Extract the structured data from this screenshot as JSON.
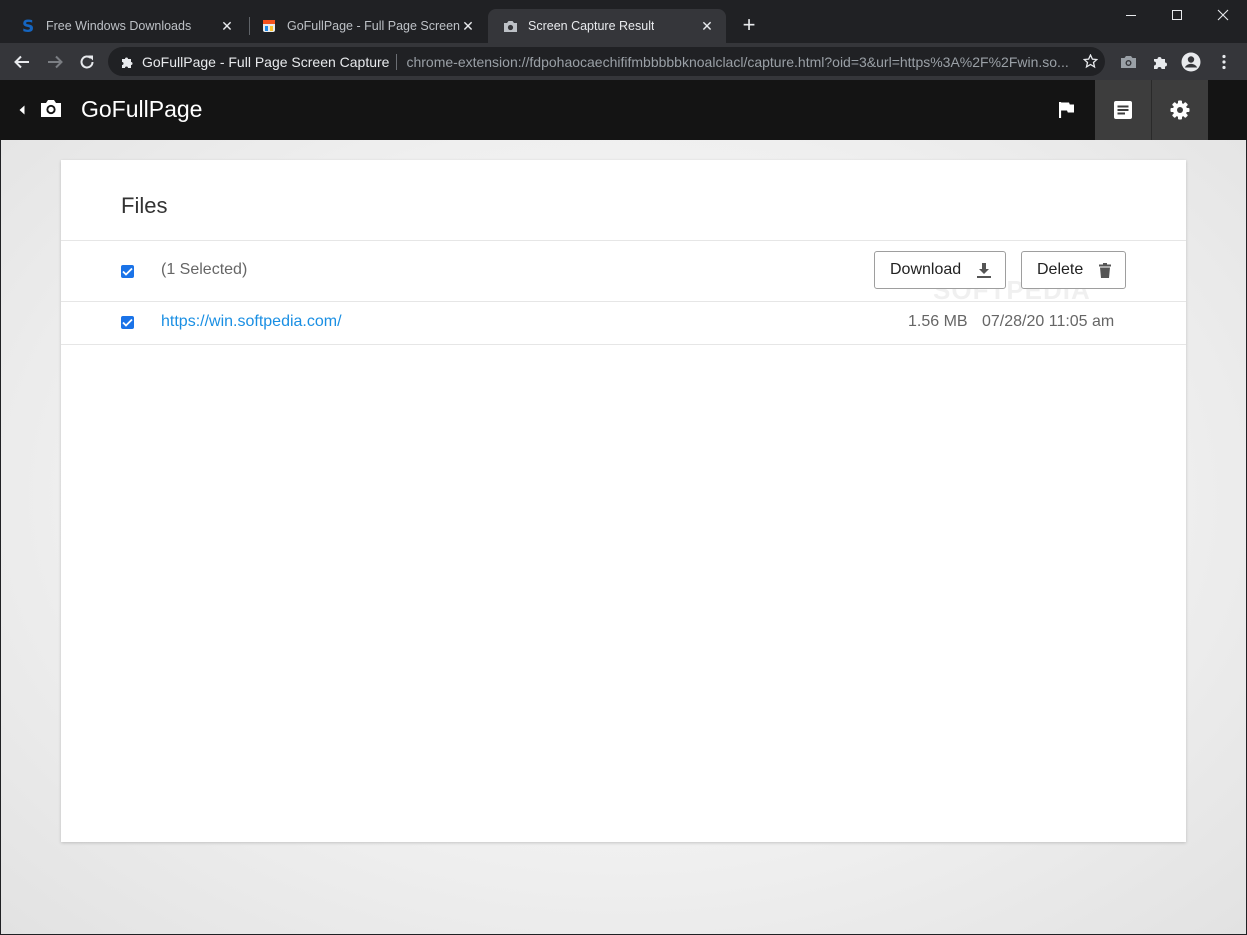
{
  "browser": {
    "tabs": [
      {
        "title": "Free Windows Downloads",
        "favicon": "softpedia-s-icon",
        "active": false
      },
      {
        "title": "GoFullPage - Full Page Screen Ca",
        "favicon": "gofullpage-icon",
        "active": false
      },
      {
        "title": "Screen Capture Result",
        "favicon": "camera-icon",
        "active": true
      }
    ],
    "new_tab_label": "+",
    "omnibox": {
      "site_name": "GoFullPage - Full Page Screen Capture",
      "url": "chrome-extension://fdpohaocaechififmbbbbbknoalclacl/capture.html?oid=3&url=https%3A%2F%2Fwin.so..."
    }
  },
  "app": {
    "title": "GoFullPage",
    "header_buttons": [
      "flag-icon",
      "list-icon",
      "gear-icon"
    ],
    "active_header_button": "list-icon"
  },
  "files": {
    "title": "Files",
    "selection_text": "(1 Selected)",
    "select_all_checked": true,
    "buttons": {
      "download": "Download",
      "delete": "Delete"
    },
    "items": [
      {
        "name": "https://win.softpedia.com/",
        "size": "1.56 MB",
        "date": "07/28/20 11:05 am",
        "checked": true
      }
    ]
  },
  "watermark": "SOFTPEDIA",
  "colors": {
    "accent": "#1a73e8",
    "link": "#1a8fe3",
    "appbar": "#141414",
    "chrome_dark": "#202124"
  }
}
